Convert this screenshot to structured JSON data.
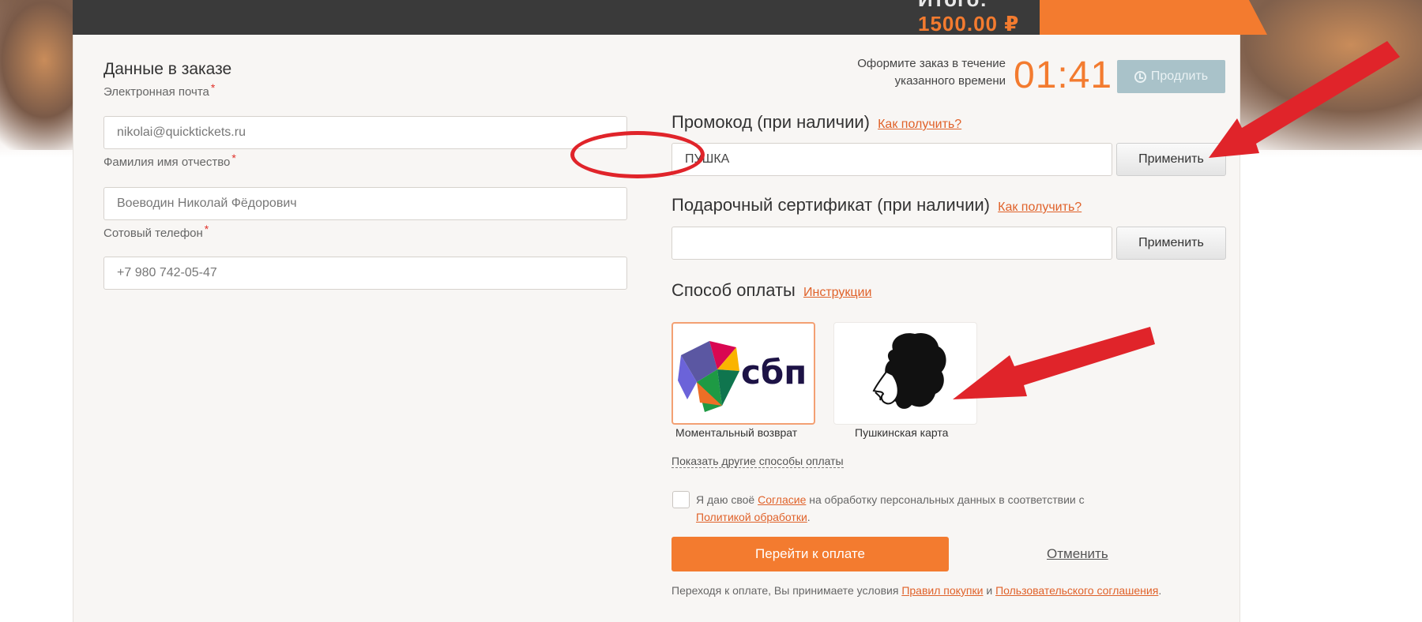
{
  "header": {
    "total_label": "Итого:",
    "total_amount": "1500.00 ₽"
  },
  "order_form": {
    "title": "Данные в заказе",
    "email": {
      "label": "Электронная почта",
      "value": "nikolai@quicktickets.ru",
      "required_mark": "*"
    },
    "fullname": {
      "label": "Фамилия имя отчество",
      "value": "Воеводин Николай Фёдорович",
      "required_mark": "*"
    },
    "phone": {
      "label": "Сотовый телефон",
      "value": "+7 980 742-05-47",
      "required_mark": "*"
    }
  },
  "timer": {
    "text_line1": "Оформите заказ в течение",
    "text_line2": "указанного времени",
    "time": "01:41",
    "extend_label": "Продлить"
  },
  "promo": {
    "heading": "Промокод (при наличии)",
    "help_link": "Как получить?",
    "value": "ПУШКА",
    "apply_label": "Применить"
  },
  "gift_certificate": {
    "heading": "Подарочный сертификат (при наличии)",
    "help_link": "Как получить?",
    "value": "",
    "apply_label": "Применить"
  },
  "payment": {
    "heading": "Способ оплаты",
    "instructions_link": "Инструкции",
    "methods": [
      {
        "logo_text": "сбп",
        "caption": "Моментальный возврат",
        "selected": true
      },
      {
        "logo_text": "",
        "caption": "Пушкинская карта",
        "selected": false
      }
    ],
    "more_link": "Показать другие способы оплаты"
  },
  "consent": {
    "text_before": "Я даю своё ",
    "link1": "Согласие",
    "text_middle": " на обработку персональных данных в соответствии с ",
    "link2": "Политикой обработки",
    "text_after": "."
  },
  "actions": {
    "pay_label": "Перейти к оплате",
    "cancel_label": "Отменить"
  },
  "terms": {
    "text_before": "Переходя к оплате, Вы принимаете условия ",
    "link1": "Правил покупки",
    "text_middle": " и ",
    "link2": "Пользовательского соглашения",
    "text_after": "."
  },
  "colors": {
    "accent": "#f37b2f",
    "annotation_red": "#e0242a",
    "header_dark": "#3a3a3a",
    "card_bg": "#f8f6f4",
    "extend_btn": "#a9c2c9"
  }
}
